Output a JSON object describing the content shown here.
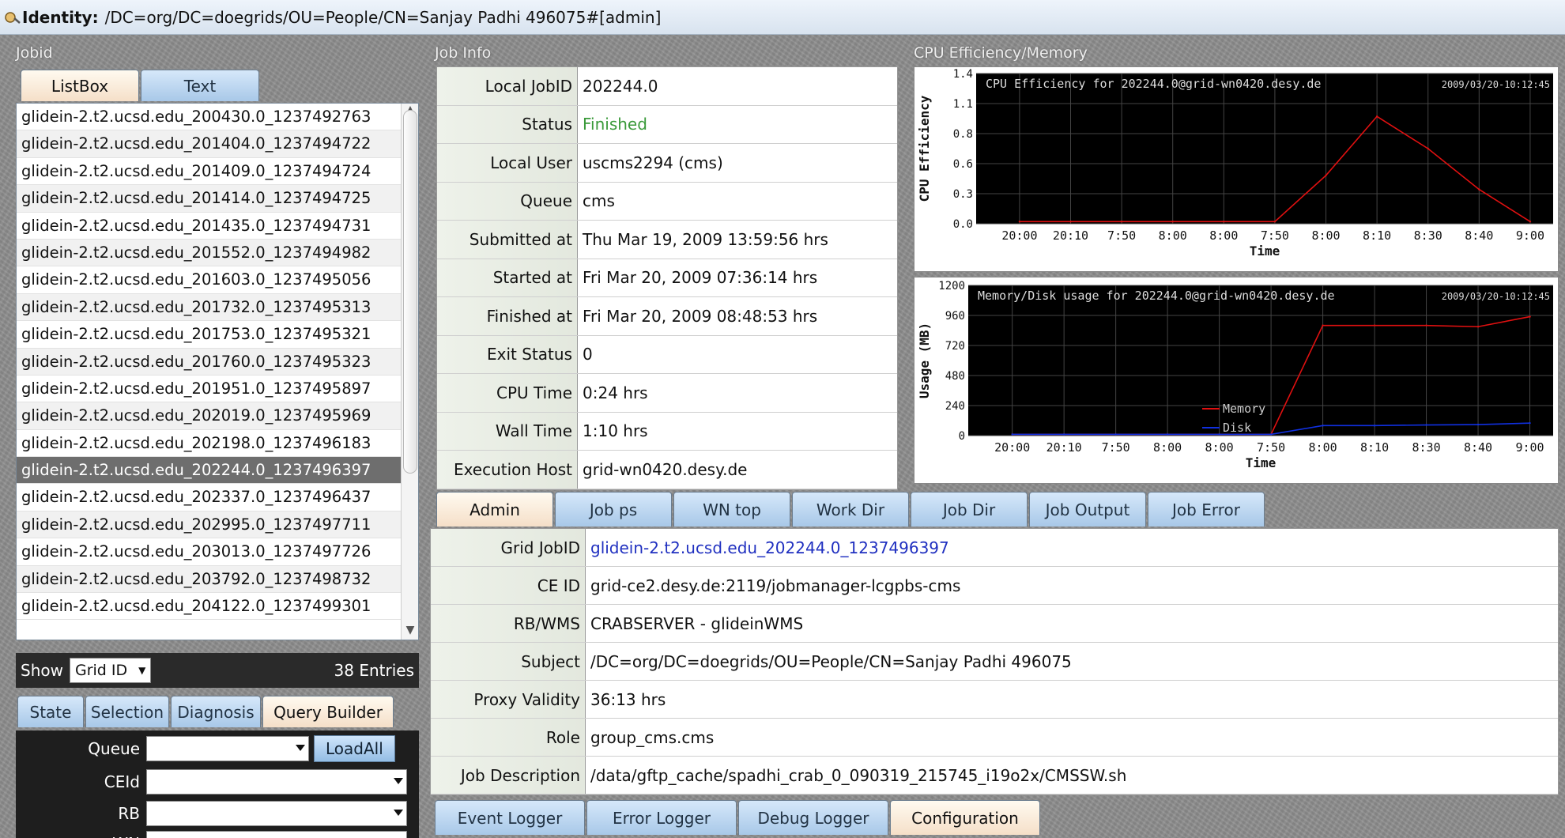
{
  "identity": {
    "label": "Identity:",
    "value": "/DC=org/DC=doegrids/OU=People/CN=Sanjay Padhi 496075#[admin]"
  },
  "sections": {
    "jobid": "Jobid",
    "job_info": "Job Info",
    "cpu_mem": "CPU Efficiency/Memory"
  },
  "left_tabs": [
    "ListBox",
    "Text"
  ],
  "job_list": [
    "glidein-2.t2.ucsd.edu_200430.0_1237492763",
    "glidein-2.t2.ucsd.edu_201404.0_1237494722",
    "glidein-2.t2.ucsd.edu_201409.0_1237494724",
    "glidein-2.t2.ucsd.edu_201414.0_1237494725",
    "glidein-2.t2.ucsd.edu_201435.0_1237494731",
    "glidein-2.t2.ucsd.edu_201552.0_1237494982",
    "glidein-2.t2.ucsd.edu_201603.0_1237495056",
    "glidein-2.t2.ucsd.edu_201732.0_1237495313",
    "glidein-2.t2.ucsd.edu_201753.0_1237495321",
    "glidein-2.t2.ucsd.edu_201760.0_1237495323",
    "glidein-2.t2.ucsd.edu_201951.0_1237495897",
    "glidein-2.t2.ucsd.edu_202019.0_1237495969",
    "glidein-2.t2.ucsd.edu_202198.0_1237496183",
    "glidein-2.t2.ucsd.edu_202244.0_1237496397",
    "glidein-2.t2.ucsd.edu_202337.0_1237496437",
    "glidein-2.t2.ucsd.edu_202995.0_1237497711",
    "glidein-2.t2.ucsd.edu_203013.0_1237497726",
    "glidein-2.t2.ucsd.edu_203792.0_1237498732",
    "glidein-2.t2.ucsd.edu_204122.0_1237499301"
  ],
  "selected_index": 13,
  "showbar": {
    "show": "Show",
    "select": "Grid ID",
    "entries": "38 Entries"
  },
  "filter_tabs": [
    "State",
    "Selection",
    "Diagnosis",
    "Query Builder"
  ],
  "query": {
    "queue": "Queue",
    "ceid": "CEId",
    "rb": "RB",
    "wn": "WN",
    "loadall": "LoadAll"
  },
  "job_info": [
    {
      "key": "Local JobID",
      "value": "202244.0"
    },
    {
      "key": "Status",
      "value": "Finished"
    },
    {
      "key": "Local User",
      "value": "uscms2294 (cms)"
    },
    {
      "key": "Queue",
      "value": "cms"
    },
    {
      "key": "Submitted at",
      "value": "Thu Mar 19, 2009 13:59:56 hrs"
    },
    {
      "key": "Started at",
      "value": "Fri Mar 20, 2009 07:36:14 hrs"
    },
    {
      "key": "Finished at",
      "value": "Fri Mar 20, 2009 08:48:53 hrs"
    },
    {
      "key": "Exit Status",
      "value": "0"
    },
    {
      "key": "CPU Time",
      "value": "0:24 hrs"
    },
    {
      "key": "Wall Time",
      "value": "1:10 hrs"
    },
    {
      "key": "Execution Host",
      "value": "grid-wn0420.desy.de"
    }
  ],
  "detail_tabs": [
    "Admin",
    "Job ps",
    "WN top",
    "Work Dir",
    "Job Dir",
    "Job Output",
    "Job Error"
  ],
  "admin_info": [
    {
      "key": "Grid JobID",
      "value": "glidein-2.t2.ucsd.edu_202244.0_1237496397"
    },
    {
      "key": "CE ID",
      "value": "grid-ce2.desy.de:2119/jobmanager-lcgpbs-cms"
    },
    {
      "key": "RB/WMS",
      "value": "CRABSERVER - glideinWMS"
    },
    {
      "key": "Subject",
      "value": "/DC=org/DC=doegrids/OU=People/CN=Sanjay Padhi 496075"
    },
    {
      "key": "Proxy Validity",
      "value": "36:13 hrs"
    },
    {
      "key": "Role",
      "value": "group_cms.cms"
    },
    {
      "key": "Job Description",
      "value": "/data/gftp_cache/spadhi_crab_0_090319_215745_i19o2x/CMSSW.sh"
    }
  ],
  "bottom_tabs": [
    "Event Logger",
    "Error Logger",
    "Debug Logger",
    "Configuration"
  ],
  "colors": {
    "memory": "#e01010",
    "disk": "#1030e0",
    "cpu": "#e01010"
  },
  "chart_data": [
    {
      "type": "line",
      "title": "CPU Efficiency for 202244.0@grid-wn0420.desy.de",
      "timestamp": "2009/03/20-10:12:45",
      "xlabel": "Time",
      "ylabel": "CPU Efficiency",
      "categories": [
        "20:00",
        "20:10",
        "7:50",
        "8:00",
        "8:00",
        "7:50",
        "8:00",
        "8:10",
        "8:30",
        "8:40",
        "9:00"
      ],
      "yticks": [
        "0.0",
        "0.3",
        "0.6",
        "0.8",
        "1.1",
        "1.4"
      ],
      "ylim": [
        0,
        1.4
      ],
      "series": [
        {
          "values": [
            0.02,
            0.02,
            0.02,
            0.02,
            0.02,
            0.02,
            0.45,
            1.0,
            0.7,
            0.32,
            0.02
          ]
        }
      ]
    },
    {
      "type": "line",
      "title": "Memory/Disk usage for 202244.0@grid-wn0420.desy.de",
      "timestamp": "2009/03/20-10:12:45",
      "xlabel": "Time",
      "ylabel": "Usage (MB)",
      "categories": [
        "20:00",
        "20:10",
        "7:50",
        "8:00",
        "8:00",
        "7:50",
        "8:00",
        "8:10",
        "8:30",
        "8:40",
        "9:00"
      ],
      "yticks": [
        "0",
        "240",
        "480",
        "720",
        "960",
        "1200"
      ],
      "ylim": [
        0,
        1200
      ],
      "legend": "inside-bottom-right",
      "series": [
        {
          "name": "Memory",
          "values": [
            10,
            10,
            10,
            10,
            10,
            10,
            880,
            880,
            880,
            870,
            950
          ]
        },
        {
          "name": "Disk",
          "values": [
            10,
            10,
            10,
            10,
            10,
            10,
            80,
            80,
            85,
            88,
            100
          ]
        }
      ]
    }
  ]
}
